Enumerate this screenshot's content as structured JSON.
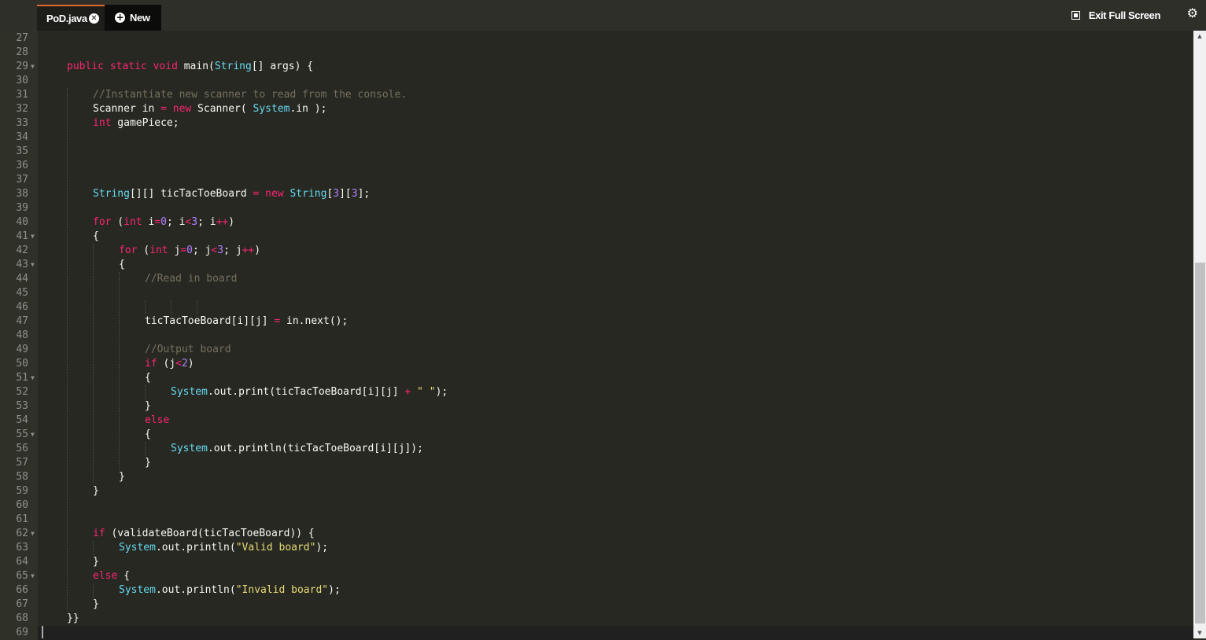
{
  "tabs": [
    {
      "label": "PoD.java",
      "active": true,
      "close_icon": "close-circle-icon"
    },
    {
      "label": "New",
      "icon": "plus-circle-icon"
    }
  ],
  "toolbar": {
    "exit_fullscreen_label": "Exit Full Screen",
    "exit_fullscreen_icon": "fullscreen-exit-icon",
    "settings_icon": "gear-icon"
  },
  "colors": {
    "background": "#272822",
    "keyword": "#f92672",
    "type": "#66d9ef",
    "comment": "#75715e",
    "number": "#ae81ff",
    "string": "#e6db74",
    "text": "#f8f8f2",
    "tab_accent": "#e0692a"
  },
  "editor": {
    "lines": [
      {
        "n": "27",
        "fold": false,
        "indent": 0,
        "tokens": []
      },
      {
        "n": "28",
        "fold": false,
        "indent": 0,
        "tokens": []
      },
      {
        "n": "29",
        "fold": true,
        "indent": 0,
        "tokens": [
          [
            "kw",
            "public"
          ],
          [
            "t",
            " "
          ],
          [
            "kw",
            "static"
          ],
          [
            "t",
            " "
          ],
          [
            "kw",
            "void"
          ],
          [
            "t",
            " main("
          ],
          [
            "ty",
            "String"
          ],
          [
            "t",
            "[] args) {"
          ]
        ]
      },
      {
        "n": "30",
        "fold": false,
        "indent": 0,
        "tokens": []
      },
      {
        "n": "31",
        "fold": false,
        "indent": 1,
        "tokens": [
          [
            "cm",
            "//Instantiate new scanner to read from the console."
          ]
        ]
      },
      {
        "n": "32",
        "fold": false,
        "indent": 1,
        "tokens": [
          [
            "t",
            "Scanner in "
          ],
          [
            "op",
            "="
          ],
          [
            "t",
            " "
          ],
          [
            "kw",
            "new"
          ],
          [
            "t",
            " Scanner( "
          ],
          [
            "ty",
            "System"
          ],
          [
            "t",
            ".in );"
          ]
        ]
      },
      {
        "n": "33",
        "fold": false,
        "indent": 1,
        "tokens": [
          [
            "kw",
            "int"
          ],
          [
            "t",
            " gamePiece;"
          ]
        ]
      },
      {
        "n": "34",
        "fold": false,
        "indent": 0,
        "tokens": []
      },
      {
        "n": "35",
        "fold": false,
        "indent": 0,
        "tokens": []
      },
      {
        "n": "36",
        "fold": false,
        "indent": 0,
        "tokens": []
      },
      {
        "n": "37",
        "fold": false,
        "indent": 0,
        "tokens": []
      },
      {
        "n": "38",
        "fold": false,
        "indent": 1,
        "tokens": [
          [
            "ty",
            "String"
          ],
          [
            "t",
            "[][] ticTacToeBoard "
          ],
          [
            "op",
            "="
          ],
          [
            "t",
            " "
          ],
          [
            "kw",
            "new"
          ],
          [
            "t",
            " "
          ],
          [
            "ty",
            "String"
          ],
          [
            "t",
            "["
          ],
          [
            "nu",
            "3"
          ],
          [
            "t",
            "]["
          ],
          [
            "nu",
            "3"
          ],
          [
            "t",
            "];"
          ]
        ]
      },
      {
        "n": "39",
        "fold": false,
        "indent": 0,
        "tokens": []
      },
      {
        "n": "40",
        "fold": false,
        "indent": 1,
        "tokens": [
          [
            "kw",
            "for"
          ],
          [
            "t",
            " ("
          ],
          [
            "kw",
            "int"
          ],
          [
            "t",
            " i"
          ],
          [
            "op",
            "="
          ],
          [
            "nu",
            "0"
          ],
          [
            "t",
            "; i"
          ],
          [
            "op",
            "<"
          ],
          [
            "nu",
            "3"
          ],
          [
            "t",
            "; i"
          ],
          [
            "op",
            "++"
          ],
          [
            "t",
            ")"
          ]
        ]
      },
      {
        "n": "41",
        "fold": true,
        "indent": 1,
        "tokens": [
          [
            "t",
            "{"
          ]
        ]
      },
      {
        "n": "42",
        "fold": false,
        "indent": 2,
        "tokens": [
          [
            "kw",
            "for"
          ],
          [
            "t",
            " ("
          ],
          [
            "kw",
            "int"
          ],
          [
            "t",
            " j"
          ],
          [
            "op",
            "="
          ],
          [
            "nu",
            "0"
          ],
          [
            "t",
            "; j"
          ],
          [
            "op",
            "<"
          ],
          [
            "nu",
            "3"
          ],
          [
            "t",
            "; j"
          ],
          [
            "op",
            "++"
          ],
          [
            "t",
            ")"
          ]
        ]
      },
      {
        "n": "43",
        "fold": true,
        "indent": 2,
        "tokens": [
          [
            "t",
            "{"
          ]
        ]
      },
      {
        "n": "44",
        "fold": false,
        "indent": 3,
        "tokens": [
          [
            "cm",
            "//Read in board"
          ]
        ]
      },
      {
        "n": "45",
        "fold": false,
        "indent": 0,
        "tokens": []
      },
      {
        "n": "46",
        "fold": false,
        "indent": 0,
        "tokens": []
      },
      {
        "n": "47",
        "fold": false,
        "indent": 3,
        "tokens": [
          [
            "t",
            "ticTacToeBoard[i][j] "
          ],
          [
            "op",
            "="
          ],
          [
            "t",
            " in.next();"
          ]
        ]
      },
      {
        "n": "48",
        "fold": false,
        "indent": 0,
        "tokens": []
      },
      {
        "n": "49",
        "fold": false,
        "indent": 3,
        "tokens": [
          [
            "cm",
            "//Output board"
          ]
        ]
      },
      {
        "n": "50",
        "fold": false,
        "indent": 3,
        "tokens": [
          [
            "kw",
            "if"
          ],
          [
            "t",
            " (j"
          ],
          [
            "op",
            "<"
          ],
          [
            "nu",
            "2"
          ],
          [
            "t",
            ")"
          ]
        ]
      },
      {
        "n": "51",
        "fold": true,
        "indent": 3,
        "tokens": [
          [
            "t",
            "{"
          ]
        ]
      },
      {
        "n": "52",
        "fold": false,
        "indent": 4,
        "tokens": [
          [
            "ty",
            "System"
          ],
          [
            "t",
            ".out.print(ticTacToeBoard[i][j] "
          ],
          [
            "op",
            "+"
          ],
          [
            "t",
            " "
          ],
          [
            "st",
            "\" \""
          ],
          [
            "t",
            ");"
          ]
        ]
      },
      {
        "n": "53",
        "fold": false,
        "indent": 3,
        "tokens": [
          [
            "t",
            "}"
          ]
        ]
      },
      {
        "n": "54",
        "fold": false,
        "indent": 3,
        "tokens": [
          [
            "kw",
            "else"
          ]
        ]
      },
      {
        "n": "55",
        "fold": true,
        "indent": 3,
        "tokens": [
          [
            "t",
            "{"
          ]
        ]
      },
      {
        "n": "56",
        "fold": false,
        "indent": 4,
        "tokens": [
          [
            "ty",
            "System"
          ],
          [
            "t",
            ".out.println(ticTacToeBoard[i][j]);"
          ]
        ]
      },
      {
        "n": "57",
        "fold": false,
        "indent": 3,
        "tokens": [
          [
            "t",
            "}"
          ]
        ]
      },
      {
        "n": "58",
        "fold": false,
        "indent": 2,
        "tokens": [
          [
            "t",
            "}"
          ]
        ]
      },
      {
        "n": "59",
        "fold": false,
        "indent": 1,
        "tokens": [
          [
            "t",
            "}"
          ]
        ]
      },
      {
        "n": "60",
        "fold": false,
        "indent": 0,
        "tokens": []
      },
      {
        "n": "61",
        "fold": false,
        "indent": 0,
        "tokens": []
      },
      {
        "n": "62",
        "fold": true,
        "indent": 1,
        "tokens": [
          [
            "kw",
            "if"
          ],
          [
            "t",
            " (validateBoard(ticTacToeBoard)) {"
          ]
        ]
      },
      {
        "n": "63",
        "fold": false,
        "indent": 2,
        "tokens": [
          [
            "ty",
            "System"
          ],
          [
            "t",
            ".out.println("
          ],
          [
            "st",
            "\"Valid board\""
          ],
          [
            "t",
            ");"
          ]
        ]
      },
      {
        "n": "64",
        "fold": false,
        "indent": 1,
        "tokens": [
          [
            "t",
            "}"
          ]
        ]
      },
      {
        "n": "65",
        "fold": true,
        "indent": 1,
        "tokens": [
          [
            "kw",
            "else"
          ],
          [
            "t",
            " {"
          ]
        ]
      },
      {
        "n": "66",
        "fold": false,
        "indent": 2,
        "tokens": [
          [
            "ty",
            "System"
          ],
          [
            "t",
            ".out.println("
          ],
          [
            "st",
            "\"Invalid board\""
          ],
          [
            "t",
            ");"
          ]
        ]
      },
      {
        "n": "67",
        "fold": false,
        "indent": 1,
        "tokens": [
          [
            "t",
            "}"
          ]
        ]
      },
      {
        "n": "68",
        "fold": false,
        "indent": 0,
        "tokens": [
          [
            "t",
            "}}"
          ]
        ]
      },
      {
        "n": "69",
        "fold": false,
        "indent": 0,
        "tokens": [],
        "active": true
      }
    ]
  },
  "scrollbar": {
    "position_fraction": 0.38,
    "visible_fraction": 0.6
  }
}
